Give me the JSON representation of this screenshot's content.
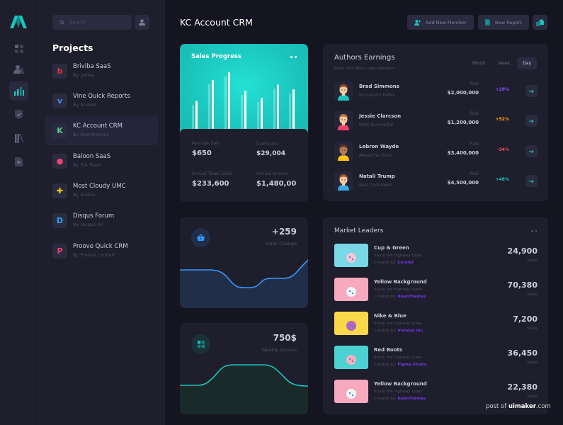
{
  "rail": {
    "items": [
      {
        "icon": "dashboard-grid-icon",
        "active": false
      },
      {
        "icon": "users-icon",
        "active": false
      },
      {
        "icon": "bar-chart-icon",
        "active": true
      },
      {
        "icon": "shield-icon",
        "active": false
      },
      {
        "icon": "library-icon",
        "active": false
      },
      {
        "icon": "add-file-icon",
        "active": false
      }
    ]
  },
  "panel": {
    "search_placeholder": "Search",
    "title": "Projects",
    "projects": [
      {
        "name": "Briviba SaaS",
        "by": "By James",
        "glyph": "b",
        "color": "#e2313f",
        "active": false
      },
      {
        "name": "Vine Quick Reports",
        "by": "By Andres",
        "glyph": "v",
        "color": "#3b8ff3",
        "active": false
      },
      {
        "name": "KC Account CRM",
        "by": "By Keenthemes",
        "glyph": "K",
        "color": "#50cd89",
        "active": true
      },
      {
        "name": "Baloon SaaS",
        "by": "By SIA Team",
        "glyph": "●",
        "color": "#f1416c",
        "active": false
      },
      {
        "name": "Most Cloudy UMC",
        "by": "By Andrei",
        "glyph": "✚",
        "color": "#ffc700",
        "active": false
      },
      {
        "name": "Disqus Forum",
        "by": "By Disqus Inc.",
        "glyph": "D",
        "color": "#2e9fff",
        "active": false
      },
      {
        "name": "Proove Quick CRM",
        "by": "By Proove Limited",
        "glyph": "P",
        "color": "#f1416c",
        "active": false
      }
    ]
  },
  "header": {
    "title": "KC Account CRM",
    "add_member": "Add New Member",
    "new_report": "New Report"
  },
  "sales_progress": {
    "title": "Sales Progress",
    "stats": [
      {
        "label": "Avarage Sale",
        "value": "$650"
      },
      {
        "label": "Comission",
        "value": "$29,004"
      },
      {
        "label": "Annual Taxes 2019",
        "value": "$233,600"
      },
      {
        "label": "Annual Income",
        "value": "$1,480,00"
      }
    ]
  },
  "authors": {
    "title": "Authors Earnings",
    "subtitle": "More than 400+ new members",
    "tabs": [
      "Month",
      "Week",
      "Day"
    ],
    "active_tab": "Day",
    "rows": [
      {
        "name": "Brad Simmons",
        "role": "Successful Fellas",
        "paid_label": "Paid",
        "amount": "$2,000,000",
        "change": "+28%",
        "change_color": "#8950fc",
        "hair": "#8b4a2b",
        "shirt": "#1bc5bd",
        "skin": "#f6c9a0"
      },
      {
        "name": "Jessie Clarcson",
        "role": "Most Successful",
        "paid_label": "Paid",
        "amount": "$1,200,000",
        "change": "+52%",
        "change_color": "#ffa800",
        "hair": "#b9763a",
        "shirt": "#f1416c",
        "skin": "#f6c9a0"
      },
      {
        "name": "Lebron Wayde",
        "role": "Awesome Users",
        "paid_label": "Paid",
        "amount": "$3,400,000",
        "change": "-34%",
        "change_color": "#f64e60",
        "hair": "#5a3622",
        "shirt": "#ffc700",
        "skin": "#b87c52"
      },
      {
        "name": "Natali Trump",
        "role": "Best Customers",
        "paid_label": "Paid",
        "amount": "$4,500,000",
        "change": "+48%",
        "change_color": "#1bc5bd",
        "hair": "#9c5a30",
        "shirt": "#3ba8e6",
        "skin": "#f6c9a0"
      }
    ]
  },
  "sales_change": {
    "value": "+259",
    "label": "Sales Change",
    "color": "#3699ff"
  },
  "weekly_income": {
    "value": "750$",
    "label": "Weekly Income",
    "color": "#1bc5bd"
  },
  "market": {
    "title": "Market Leaders",
    "rows": [
      {
        "name": "Cup & Green",
        "desc": "Study the highway types",
        "by_label": "Created by:",
        "creator": "CoreAd",
        "sales": "24,900",
        "sales_label": "Sales",
        "thumb": "#7ad7e5",
        "obj": "#f5c6d6"
      },
      {
        "name": "Yellow Background",
        "desc": "Study the highway types",
        "by_label": "Created by:",
        "creator": "KeenThemes",
        "sales": "70,380",
        "sales_label": "Sales",
        "thumb": "#f9a9be",
        "obj": "#eef5f6"
      },
      {
        "name": "Nike & Blue",
        "desc": "Study the highway types",
        "by_label": "Created by:",
        "creator": "Invision Inc.",
        "sales": "7,200",
        "sales_label": "Sales",
        "thumb": "#f9d84a",
        "obj": "#b266c0"
      },
      {
        "name": "Red Boots",
        "desc": "Study the highway types",
        "by_label": "Created by:",
        "creator": "Figma Studio",
        "sales": "36,450",
        "sales_label": "Sales",
        "thumb": "#4dd2d3",
        "obj": "#f7b2b9"
      },
      {
        "name": "Yellow Background",
        "desc": "Study the highway types",
        "by_label": "Created by:",
        "creator": "KeenThemes",
        "sales": "22,380",
        "sales_label": "Sales",
        "thumb": "#f9a9be",
        "obj": "#eef5f6"
      }
    ]
  },
  "watermark": {
    "prefix": "post of ",
    "brand": "uimaker",
    "suffix": ".com"
  }
}
